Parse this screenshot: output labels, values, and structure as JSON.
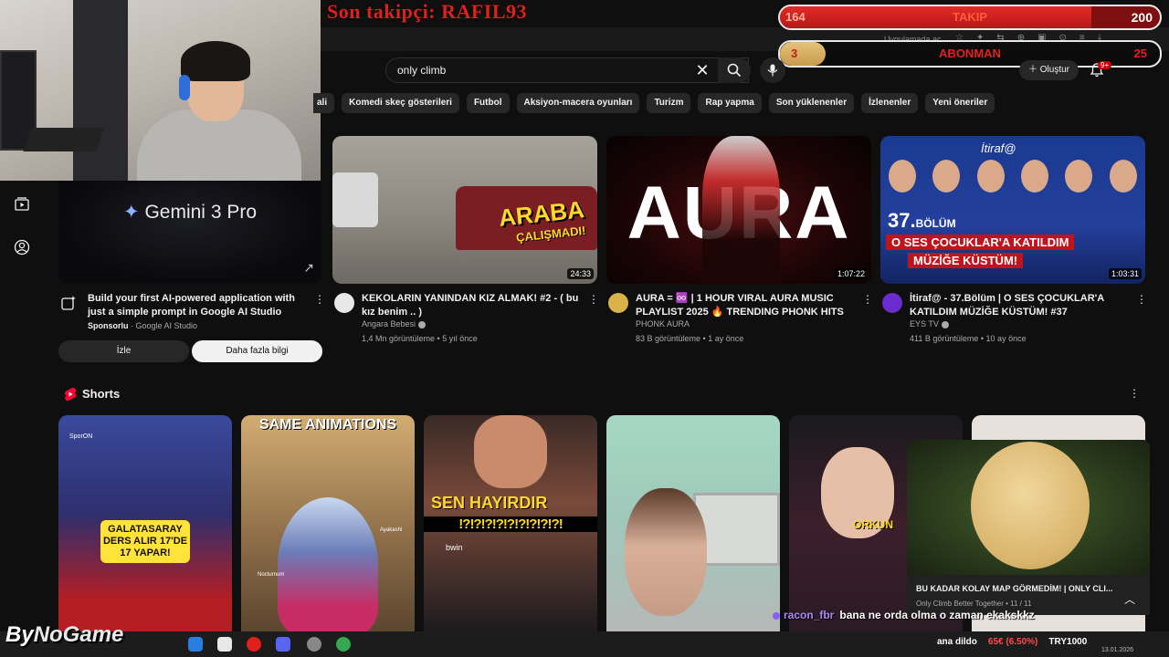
{
  "overlay": {
    "follower_ticker": "Son takipçi: RAFIL93",
    "follow_goal": {
      "current": "164",
      "label": "TAKIP",
      "target": "200",
      "progress": 0.82
    },
    "sub_goal": {
      "current": "3",
      "label": "ABONMAN",
      "target": "25",
      "progress": 0.12
    },
    "browser_hint": "Uygulamada aç"
  },
  "search": {
    "query": "only climb"
  },
  "header": {
    "create_label": "Oluştur",
    "notification_count": "9+"
  },
  "chips": [
    {
      "label": "ali"
    },
    {
      "label": "Komedi skeç gösterileri"
    },
    {
      "label": "Futbol"
    },
    {
      "label": "Aksiyon-macera oyunları"
    },
    {
      "label": "Turizm"
    },
    {
      "label": "Rap yapma"
    },
    {
      "label": "Son yüklenenler"
    },
    {
      "label": "İzlenenler"
    },
    {
      "label": "Yeni öneriler"
    }
  ],
  "ad": {
    "brand": "Gemini",
    "brand_version": "3 Pro",
    "title": "Build your first AI-powered application with just a simple prompt in Google AI Studio",
    "sponsored": "Sponsorlu",
    "advertiser": "Google AI Studio",
    "watch_label": "İzle",
    "learn_label": "Daha fazla bilgi"
  },
  "videos": [
    {
      "title": "KEKOLARIN YANINDAN KIZ ALMAK! #2 - ( bu kız benim .. )",
      "channel": "Angara Bebesi",
      "views": "1,4 Mn görüntüleme",
      "age": "5 yıl önce",
      "duration": "24:33",
      "thumb_text_1": "ARABA",
      "thumb_text_2": "ÇALIŞMADI!",
      "avatar_color": "#e8e8e8"
    },
    {
      "title": "AURA = ♾️ | 1 HOUR VIRAL AURA MUSIC PLAYLIST 2025 🔥 TRENDING PHONK HITS",
      "channel": "PHONK AURA",
      "views": "83 B görüntüleme",
      "age": "1 ay önce",
      "duration": "1:07:22",
      "thumb_text_1": "AURA",
      "avatar_color": "#d9b24a"
    },
    {
      "title": "İtiraf@ - 37.Bölüm | O SES ÇOCUKLAR'A KATILDIM MÜZİĞE KÜSTÜM! #37",
      "channel": "EYS TV",
      "views": "411 B görüntüleme",
      "age": "10 ay önce",
      "duration": "1:03:31",
      "thumb_logo": "İtiraf@",
      "thumb_ep": "37.",
      "thumb_ep_word": "BÖLÜM",
      "thumb_line_1": "O SES ÇOCUKLAR'A KATILDIM",
      "thumb_line_2": "MÜZİĞE KÜSTÜM!",
      "avatar_color": "#6a2bd1"
    }
  ],
  "shorts": {
    "section_title": "Shorts",
    "items": [
      {
        "tag": "GALATASARAY DERS ALIR 17'DE 17 YAPAR!",
        "corner": "SporON"
      },
      {
        "text": "SAME ANIMATIONS",
        "small_1": "Ayakashi",
        "small_2": "Nocturnum"
      },
      {
        "text": "SEN HAYIRDIR",
        "marks": "!?!?!?!?!?!?!?!?!?!",
        "small": "bwin"
      },
      {},
      {
        "name": "ORKUN"
      },
      {}
    ]
  },
  "mini_player": {
    "title": "BU KADAR KOLAY MAP GÖRMEDİM! | ONLY CLI...",
    "subtitle": "Only Climb Better Together • 11 / 11"
  },
  "chat": {
    "user": "racon_fbr",
    "message": "bana ne orda olma o zaman ekakskkz"
  },
  "taskbar": {
    "logo_by": "By",
    "logo_text": "NoGame",
    "ticker_word": "ana dildo",
    "ticker_price": "65€ (6.50%)",
    "ticker_donation": "TRY1000",
    "date": "13.01.2026"
  },
  "colors": {
    "accent_red": "#e0201a",
    "yt_bg": "#0f0f0f",
    "chip_bg": "#272727"
  }
}
